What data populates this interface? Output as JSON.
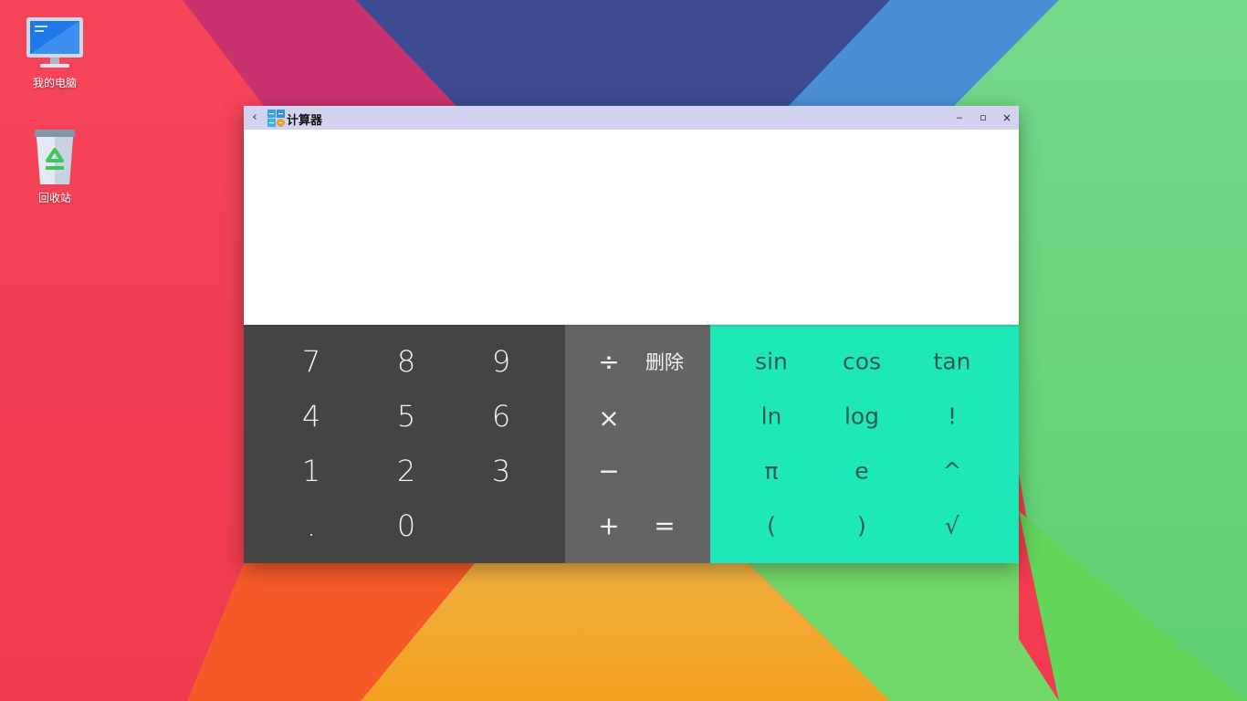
{
  "desktop": {
    "icons": [
      {
        "label": "我的电脑",
        "icon": "computer-icon"
      },
      {
        "label": "回收站",
        "icon": "trash-icon"
      }
    ]
  },
  "window": {
    "title": "计算器",
    "back_glyph": "‹",
    "minimize_glyph": "‒",
    "maximize_glyph": "▫",
    "close_glyph": "×"
  },
  "display": {
    "value": ""
  },
  "keys": {
    "numbers": [
      "7",
      "8",
      "9",
      "4",
      "5",
      "6",
      "1",
      "2",
      "3",
      ".",
      "0"
    ],
    "ops": {
      "divide": "÷",
      "delete": "删除",
      "multiply": "×",
      "minus": "−",
      "plus": "+",
      "equals": "="
    },
    "sci": [
      "sin",
      "cos",
      "tan",
      "ln",
      "log",
      "!",
      "π",
      "e",
      "^",
      "(",
      ")",
      "√"
    ]
  },
  "colors": {
    "titlebar": "#d2d3f0",
    "number_pad": "#444444",
    "operator_pad": "#646464",
    "scientific_pad": "#1fe8b8"
  }
}
